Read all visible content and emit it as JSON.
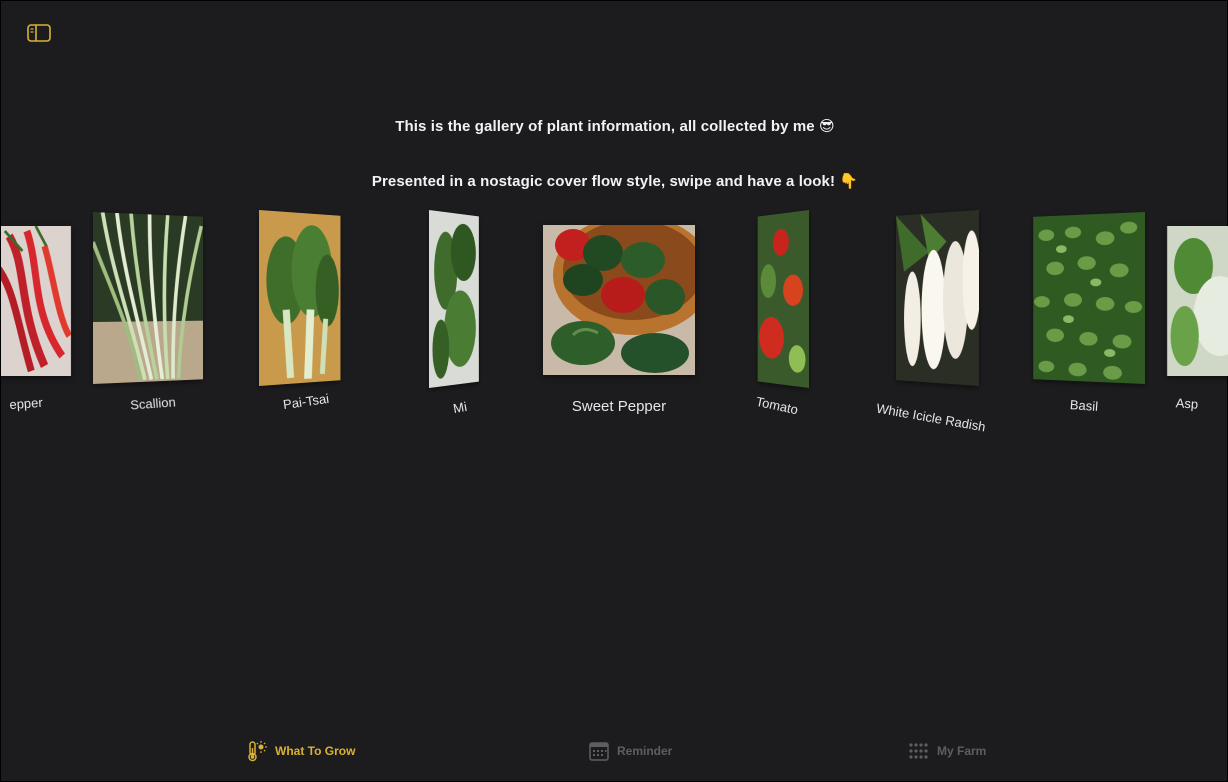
{
  "header": {
    "line1": "This is the gallery of plant information, all collected by me",
    "line1_emoji": "😎",
    "line2": "Presented in a nostagic cover flow style, swipe and have a look!",
    "line2_emoji": "👇"
  },
  "gallery": {
    "selected": "Sweet Pepper",
    "items": [
      {
        "label": "epper"
      },
      {
        "label": "Scallion"
      },
      {
        "label": "Pai-Tsai"
      },
      {
        "label": "Mi"
      },
      {
        "label": "Sweet Pepper"
      },
      {
        "label": "Tomato"
      },
      {
        "label": "White Icicle Radish"
      },
      {
        "label": "Basil"
      },
      {
        "label": "Asp"
      }
    ]
  },
  "tabbar": {
    "tabs": [
      {
        "label": "What To Grow",
        "icon": "thermometer-sun-icon",
        "active": true
      },
      {
        "label": "Reminder",
        "icon": "calendar-icon",
        "active": false
      },
      {
        "label": "My Farm",
        "icon": "grid-icon",
        "active": false
      }
    ]
  },
  "colors": {
    "background": "#1c1c1e",
    "accent": "#d9b233",
    "inactive": "#5e5e60",
    "text": "#f2f2f2"
  }
}
